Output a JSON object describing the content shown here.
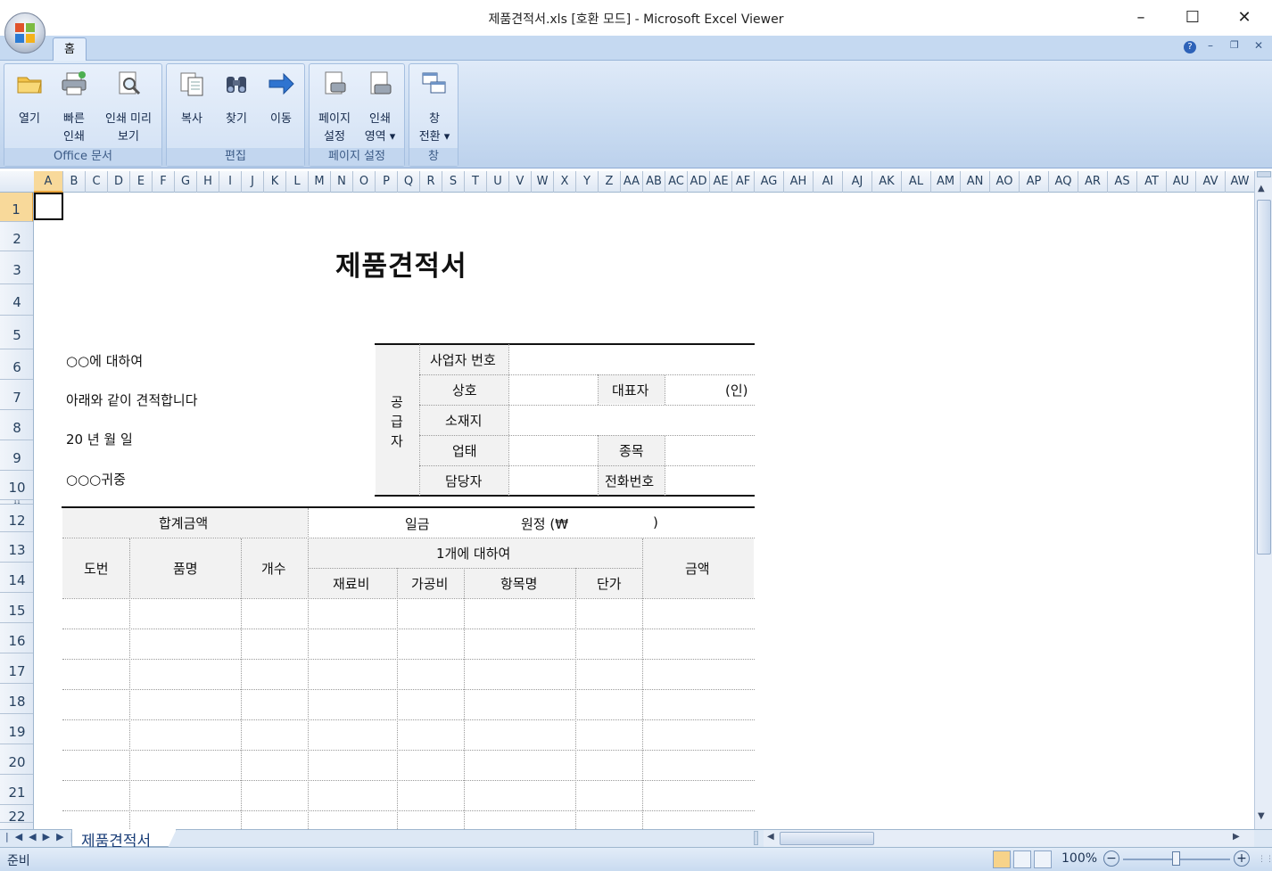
{
  "window": {
    "title": "제품견적서.xls  [호환 모드] - Microsoft Excel Viewer"
  },
  "ribbon": {
    "tab_home": "홈",
    "groups": {
      "office": "Office 문서",
      "edit": "편집",
      "page_setup": "페이지 설정",
      "window": "창"
    },
    "buttons": {
      "open": [
        "열기",
        ""
      ],
      "quick_print": [
        "빠른",
        "인쇄"
      ],
      "print_preview": [
        "인쇄 미리",
        "보기"
      ],
      "copy": [
        "복사",
        ""
      ],
      "find": [
        "찾기",
        ""
      ],
      "goto": [
        "이동",
        ""
      ],
      "page_setup": [
        "페이지",
        "설정"
      ],
      "print_area": [
        "인쇄",
        "영역 ▾"
      ],
      "switch_window": [
        "창",
        "전환 ▾"
      ]
    }
  },
  "columns": [
    "A",
    "B",
    "C",
    "D",
    "E",
    "F",
    "G",
    "H",
    "I",
    "J",
    "K",
    "L",
    "M",
    "N",
    "O",
    "P",
    "Q",
    "R",
    "S",
    "T",
    "U",
    "V",
    "W",
    "X",
    "Y",
    "Z",
    "AA",
    "AB",
    "AC",
    "AD",
    "AE",
    "AF",
    "AG",
    "AH",
    "AI",
    "AJ",
    "AK",
    "AL",
    "AM",
    "AN",
    "AO",
    "AP",
    "AQ",
    "AR",
    "AS",
    "AT",
    "AU",
    "AV",
    "AW"
  ],
  "rows": [
    "1",
    "2",
    "3",
    "4",
    "5",
    "6",
    "7",
    "8",
    "9",
    "10",
    "11",
    "12",
    "13",
    "14",
    "15",
    "16",
    "17",
    "18",
    "19",
    "20",
    "21",
    "22"
  ],
  "doc": {
    "title": "제품견적서",
    "to_line": "○○에 대하여",
    "intro": "아래와 같이 견적합니다",
    "date": "20  년  월  일",
    "recipient": "○○○귀중",
    "supplier_label": [
      "공",
      "급",
      "자"
    ],
    "biz_no": "사업자 번호",
    "company": "상호",
    "ceo": "대표자",
    "seal": "(인)",
    "address": "소재지",
    "business_type": "업태",
    "item_type": "종목",
    "contact": "담당자",
    "phone": "전화번호",
    "total_label": "합계금액",
    "total_words": "일금",
    "total_won": "원정 (₩",
    "total_close": ")",
    "col_no": "도번",
    "col_name": "품명",
    "col_qty": "개수",
    "col_per": "1개에 대하여",
    "col_material": "재료비",
    "col_process": "가공비",
    "col_item": "항목명",
    "col_unit": "단가",
    "col_amount": "금액"
  },
  "sheet_tab": "제품견적서",
  "status": {
    "ready": "준비",
    "zoom": "100%"
  }
}
